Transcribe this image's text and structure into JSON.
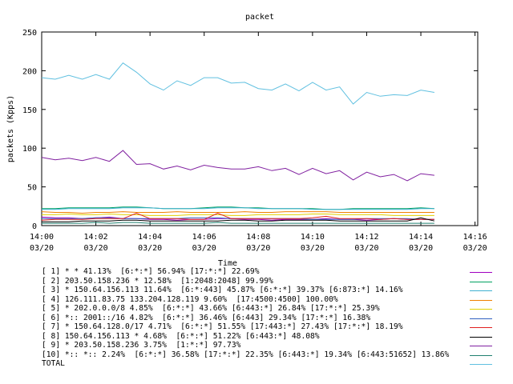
{
  "chart_data": {
    "type": "line",
    "title": "packet",
    "xlabel": "Time",
    "ylabel": "packets (Kpps)",
    "ylim": [
      0,
      250
    ],
    "yticks": [
      0,
      50,
      100,
      150,
      200,
      250
    ],
    "xticks": [
      {
        "time": "14:00",
        "date": "03/20"
      },
      {
        "time": "14:02",
        "date": "03/20"
      },
      {
        "time": "14:04",
        "date": "03/20"
      },
      {
        "time": "14:06",
        "date": "03/20"
      },
      {
        "time": "14:08",
        "date": "03/20"
      },
      {
        "time": "14:10",
        "date": "03/20"
      },
      {
        "time": "14:12",
        "date": "03/20"
      },
      {
        "time": "14:14",
        "date": "03/20"
      },
      {
        "time": "14:16",
        "date": "03/20"
      }
    ],
    "grid": false,
    "legend_position": "bottom",
    "x": [
      "14:00",
      "14:00:30",
      "14:01",
      "14:01:30",
      "14:02",
      "14:02:30",
      "14:03",
      "14:03:30",
      "14:04",
      "14:04:30",
      "14:05",
      "14:05:30",
      "14:06",
      "14:06:30",
      "14:07",
      "14:07:30",
      "14:08",
      "14:08:30",
      "14:09",
      "14:09:30",
      "14:10",
      "14:10:30",
      "14:11",
      "14:11:30",
      "14:12",
      "14:12:30",
      "14:13",
      "14:13:30",
      "14:14",
      "14:14:30"
    ],
    "series": [
      {
        "name": "[ 1] * * 41.13%  [6:*:*] 56.94% [17:*:*] 22.69%",
        "color": "#a000c0",
        "values": [
          11,
          10,
          10,
          9,
          10,
          11,
          9,
          9,
          8,
          8,
          7,
          8,
          8,
          9,
          9,
          8,
          8,
          7,
          8,
          8,
          8,
          9,
          8,
          8,
          7,
          8,
          9,
          8,
          8,
          8
        ]
      },
      {
        "name": "[ 2] 203.50.158.236 * 12.58%  [1:2048:2048] 99.99%",
        "color": "#00a060",
        "values": [
          22,
          22,
          23,
          23,
          23,
          23,
          24,
          24,
          23,
          22,
          22,
          22,
          23,
          24,
          24,
          23,
          23,
          22,
          22,
          22,
          22,
          21,
          21,
          22,
          22,
          22,
          22,
          22,
          23,
          22
        ]
      },
      {
        "name": "[ 3] * 150.64.156.113 11.64%  [6:*:443] 45.87% [6:*:*] 39.37% [6:873:*] 14.16%",
        "color": "#40b0d0",
        "values": [
          21,
          21,
          22,
          22,
          22,
          22,
          23,
          23,
          23,
          22,
          22,
          22,
          22,
          23,
          23,
          23,
          22,
          22,
          22,
          22,
          21,
          21,
          21,
          21,
          21,
          21,
          21,
          21,
          22,
          22
        ]
      },
      {
        "name": "[ 4] 126.111.83.75 133.204.128.119 9.60%  [17:4500:4500] 100.00%",
        "color": "#f08000",
        "values": [
          18,
          17,
          17,
          16,
          17,
          17,
          18,
          17,
          17,
          17,
          18,
          17,
          17,
          17,
          17,
          18,
          17,
          17,
          18,
          18,
          18,
          18,
          17,
          17,
          17,
          17,
          17,
          17,
          17,
          17
        ]
      },
      {
        "name": "[ 5] * 202.0.0.0/8 4.85%  [6:*:*] 43.66% [6:443:*] 26.84% [17:*:*] 25.39%",
        "color": "#e0d000",
        "values": [
          14,
          14,
          15,
          14,
          14,
          15,
          14,
          14,
          13,
          13,
          13,
          14,
          14,
          14,
          13,
          13,
          14,
          14,
          14,
          14,
          15,
          15,
          14,
          14,
          14,
          14,
          13,
          13,
          13,
          13
        ]
      },
      {
        "name": "[ 6] *:: 2001::/16 4.82%  [6:*:*] 36.46% [6:443] 29.34% [17:*:*] 16.38%",
        "color": "#3060c0",
        "values": [
          9,
          9,
          9,
          9,
          10,
          10,
          9,
          9,
          9,
          9,
          9,
          10,
          10,
          10,
          9,
          9,
          9,
          9,
          9,
          9,
          8,
          8,
          8,
          8,
          9,
          9,
          9,
          9,
          8,
          8
        ]
      },
      {
        "name": "[ 7] * 150.64.128.0/17 4.71%  [6:*:*] 51.55% [17:443:*] 27.43% [17:*:*] 18.19%",
        "color": "#e02020",
        "values": [
          7,
          8,
          8,
          8,
          9,
          9,
          9,
          16,
          9,
          9,
          9,
          8,
          8,
          16,
          9,
          9,
          9,
          9,
          9,
          9,
          10,
          12,
          9,
          9,
          9,
          8,
          9,
          8,
          8,
          8
        ]
      },
      {
        "name": "[ 8] 150.64.156.113 * 4.68%  [6:*:*] 51.22% [6:443:*] 48.08%",
        "color": "#000000",
        "values": [
          5,
          5,
          5,
          6,
          6,
          6,
          7,
          7,
          6,
          6,
          6,
          6,
          6,
          6,
          7,
          7,
          6,
          6,
          7,
          7,
          7,
          7,
          6,
          6,
          6,
          6,
          6,
          6,
          10,
          6
        ]
      },
      {
        "name": "[ 9] * 203.50.158.236 3.75%  [1:*:*] 97.73%",
        "color": "#8020a0",
        "values": [
          88,
          85,
          87,
          84,
          88,
          83,
          97,
          79,
          80,
          73,
          77,
          72,
          78,
          75,
          73,
          73,
          76,
          71,
          74,
          66,
          74,
          67,
          71,
          59,
          69,
          63,
          66,
          58,
          67,
          65
        ]
      },
      {
        "name": "[10] *:: *:: 2.24%  [6:*:*] 36.58% [17:*:*] 22.35% [6:443:*] 19.34% [6:443:51652] 13.86%",
        "color": "#208070",
        "values": [
          3,
          3,
          3,
          3,
          4,
          3,
          4,
          4,
          3,
          3,
          3,
          3,
          3,
          4,
          3,
          3,
          3,
          3,
          3,
          3,
          3,
          3,
          3,
          3,
          3,
          3,
          3,
          3,
          3,
          3
        ]
      },
      {
        "name": "TOTAL",
        "color": "#60c0e0",
        "values": [
          191,
          189,
          194,
          189,
          195,
          189,
          210,
          198,
          183,
          175,
          187,
          181,
          191,
          191,
          184,
          185,
          177,
          175,
          183,
          174,
          185,
          175,
          179,
          157,
          172,
          167,
          169,
          168,
          175,
          172
        ]
      }
    ]
  }
}
